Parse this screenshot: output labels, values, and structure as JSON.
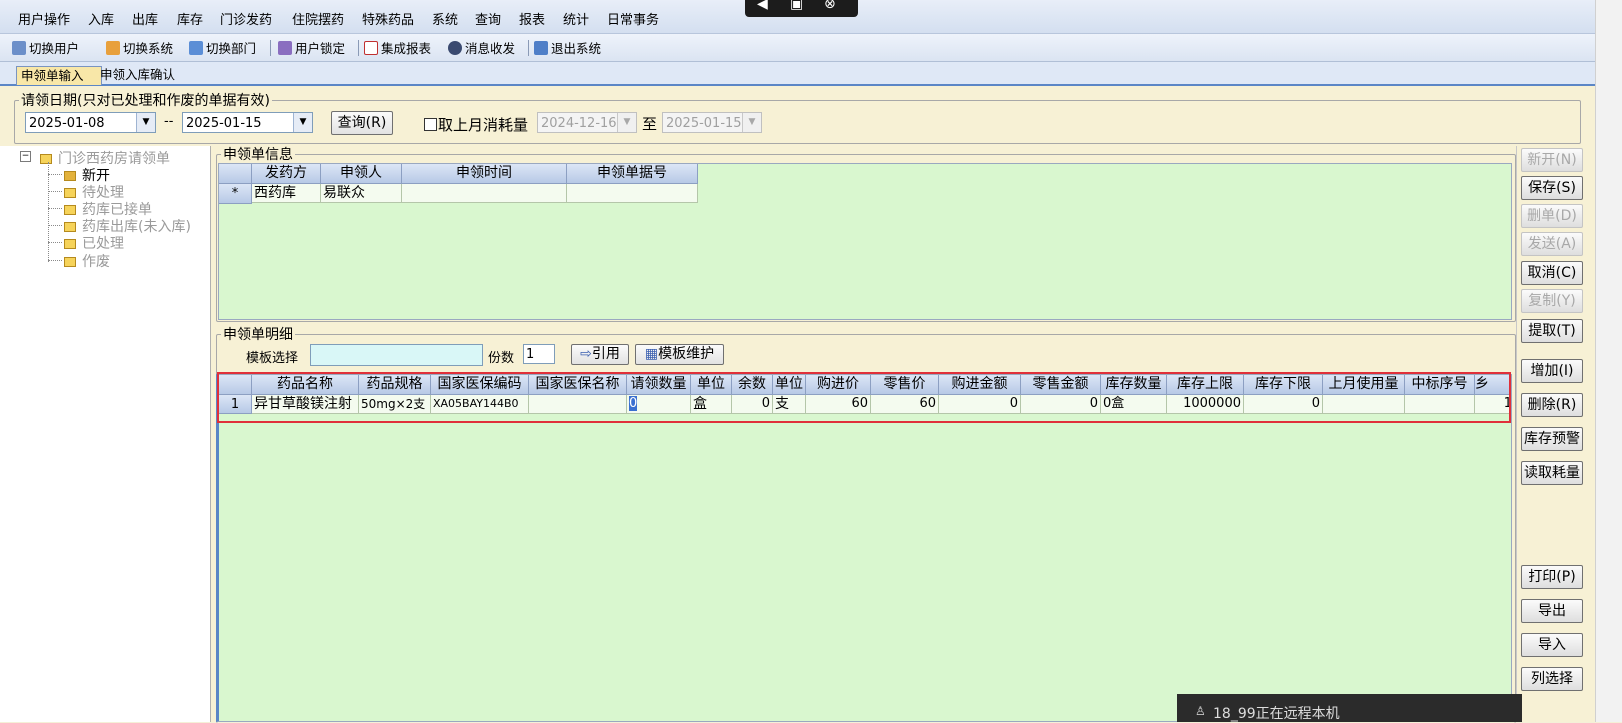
{
  "menu": [
    "用户操作",
    "入库",
    "出库",
    "库存",
    "门诊发药",
    "住院摆药",
    "特殊药品",
    "系统",
    "查询",
    "报表",
    "统计",
    "日常事务"
  ],
  "toolbar": {
    "switch_user": "切换用户",
    "switch_system": "切换系统",
    "switch_dept": "切换部门",
    "user_lock": "用户锁定",
    "integrated_report": "集成报表",
    "message": "消息收发",
    "exit": "退出系统"
  },
  "tabs": {
    "input": "申领单输入",
    "confirm": "申领入库确认"
  },
  "filter": {
    "legend": "请领日期(只对已处理和作废的单据有效)",
    "date_from": "2025-01-08",
    "dash": "--",
    "date_to": "2025-01-15",
    "query": "查询(R)",
    "last_month_label": "取上月消耗量",
    "lm_from": "2024-12-16",
    "to_label": "至",
    "lm_to": "2025-01-15"
  },
  "tree": {
    "root": "门诊西药房请领单",
    "items": [
      "新开",
      "待处理",
      "药库已接单",
      "药库出库(未入库)",
      "已处理",
      "作废"
    ]
  },
  "info": {
    "legend": "申领单信息",
    "columns": [
      "发药方",
      "申领人",
      "申领时间",
      "申领单据号"
    ],
    "row_marker": "*",
    "row": [
      "西药库",
      "易联众",
      "",
      ""
    ]
  },
  "detail": {
    "legend": "申领单明细",
    "template_label": "模板选择",
    "template_value": "",
    "copies_label": "份数",
    "copies_value": "1",
    "ref_button": "引用",
    "maint_button": "模板维护",
    "columns": [
      "药品名称",
      "药品规格",
      "国家医保编码",
      "国家医保名称",
      "请领数量",
      "单位",
      "余数",
      "单位",
      "购进价",
      "零售价",
      "购进金额",
      "零售金额",
      "库存数量",
      "库存上限",
      "库存下限",
      "上月使用量",
      "中标序号",
      "乡"
    ],
    "row_no": "1",
    "row": [
      "异甘草酸镁注射",
      "50mg×2支",
      "XA05BAY144B0",
      "",
      "0",
      "盒",
      "0",
      "支",
      "60",
      "60",
      "0",
      "0",
      "0盒",
      "1000000",
      "0",
      "",
      "",
      "1"
    ]
  },
  "side_buttons": {
    "new": "新开(N)",
    "save": "保存(S)",
    "delete": "删单(D)",
    "send": "发送(A)",
    "cancel": "取消(C)",
    "copy": "复制(Y)",
    "extract": "提取(T)",
    "add": "增加(I)",
    "remove": "删除(R)",
    "stock_warn": "库存预警",
    "read_consume": "读取耗量",
    "print": "打印(P)",
    "export": "导出",
    "import": "导入",
    "col_select": "列选择"
  },
  "notification": "18_99正在远程本机",
  "colors": {
    "grid_bg": "#d9f7cf",
    "highlight": "#e0303a",
    "tab_active": "#f8e7a8",
    "menubar": "#dce6f4"
  }
}
